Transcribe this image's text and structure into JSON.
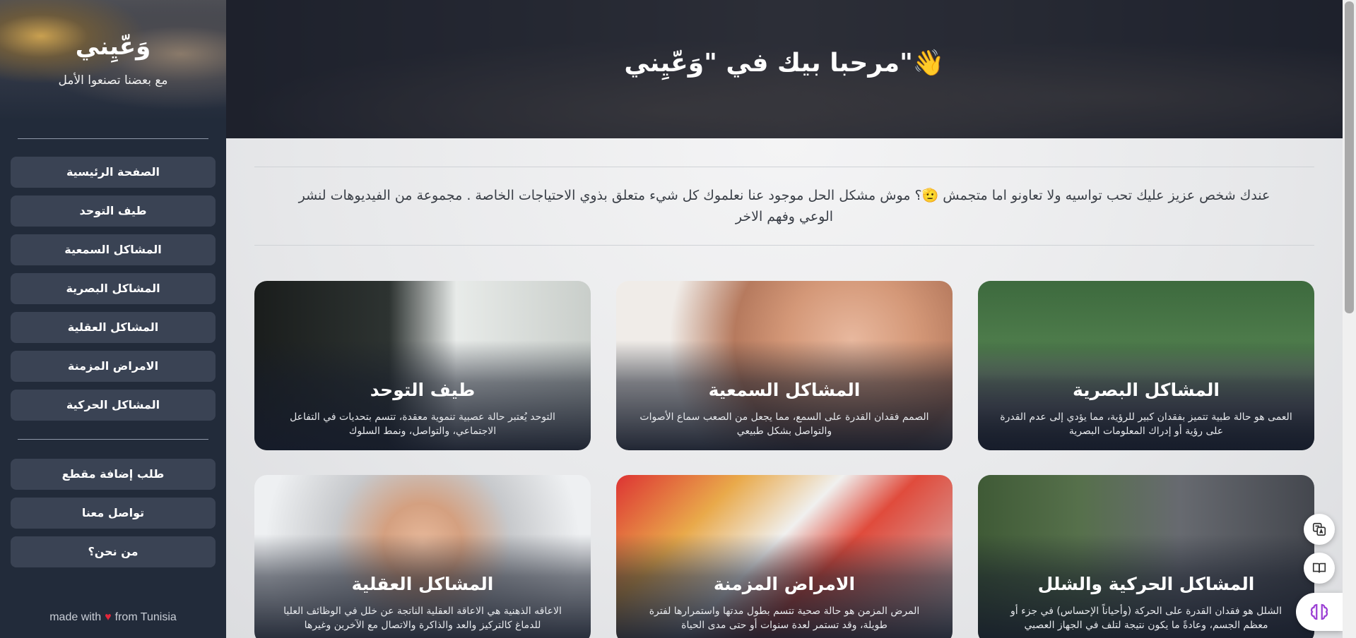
{
  "brand": {
    "title": "وَعّيِني",
    "subtitle": "مع بعضنا تصنعوا الأمل"
  },
  "sidebar": {
    "nav": [
      {
        "label": "الصفحة الرئيسية"
      },
      {
        "label": "طيف التوحد"
      },
      {
        "label": "المشاكل السمعية"
      },
      {
        "label": "المشاكل البصرية"
      },
      {
        "label": "المشاكل العقلية"
      },
      {
        "label": "الامراض المزمنة"
      },
      {
        "label": "المشاكل الحركية"
      }
    ],
    "secondary": [
      {
        "label": "طلب إضافة مقطع"
      },
      {
        "label": "تواصل معنا"
      },
      {
        "label": "من نحن؟"
      }
    ],
    "footer": {
      "made_with": "made with",
      "from": "from Tunisia"
    }
  },
  "header": {
    "title": "مرحبا بيك في \"وَعّيِني\"👋"
  },
  "intro": "عندك شخص عزيز عليك تحب تواسيه ولا تعاونو اما متجمش 🫡؟ موش مشكل الحل موجود عنا نعلموك كل شيء متعلق بذوي الاحتياجات الخاصة . مجموعة من الفيديوهات لنشر الوعي وفهم الاخر",
  "cards": [
    {
      "title": "المشاكل البصرية",
      "desc": "العمى هو حالة طبية تتميز بفقدان كبير للرؤية، مما يؤدي إلى عدم القدرة على رؤية أو إدراك المعلومات البصرية"
    },
    {
      "title": "المشاكل السمعية",
      "desc": "الصمم فقدان القدرة على السمع، مما يجعل من الصعب سماع الأصوات والتواصل بشكل طبيعي"
    },
    {
      "title": "طيف التوحد",
      "desc": "التوحد يُعتبر حالة عصبية تنموية معقدة، تتسم بتحديات في التفاعل الاجتماعي، والتواصل، ونمط السلوك"
    },
    {
      "title": "المشاكل الحركية والشلل",
      "desc": "الشلل هو فقدان القدرة على الحركة (وأحياناً الإحساس) في جزء أو معظم الجسم، وعادةً ما يكون نتيجة لتلف في الجهاز العصبي"
    },
    {
      "title": "الامراض المزمنة",
      "desc": "المرض المزمن هو حالة صحية تتسم بطول مدتها واستمرارها لفترة طويلة، وقد تستمر لعدة سنوات أو حتى مدى الحياة"
    },
    {
      "title": "المشاكل العقلية",
      "desc": "الاعاقه الذهنية هي الاعاقة العقلية الناتجة عن خلل في الوظائف العليا للدماغ كالتركيز والعد والذاكرة والاتصال مع الآخرين وغيرها"
    }
  ],
  "floating": {
    "translate_icon": "translate-icon",
    "reader_icon": "book-icon",
    "ai_icon": "brain-icon"
  }
}
